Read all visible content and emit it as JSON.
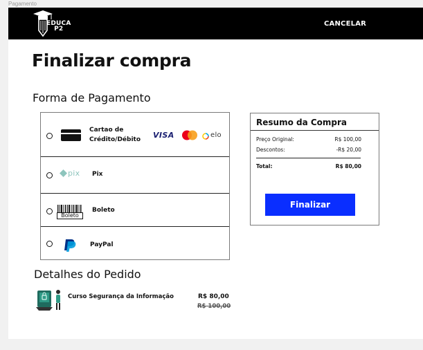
{
  "frame": {
    "label": "Pagamento"
  },
  "header": {
    "logo_line1": "EDUCA",
    "logo_line2": "P2",
    "cancel_label": "CANCELAR"
  },
  "page": {
    "title": "Finalizar compra"
  },
  "payment": {
    "section_title": "Forma de Pagamento",
    "methods": [
      {
        "label_line1": "Cartao de",
        "label_line2": "Crédito/Débito",
        "icon": "credit-card-icon",
        "brands": [
          "VISA",
          "mastercard",
          "elo"
        ]
      },
      {
        "label": "Pix",
        "icon": "pix-icon",
        "icon_text": "pix"
      },
      {
        "label": "Boleto",
        "icon": "barcode-icon",
        "icon_text": "Boleto"
      },
      {
        "label": "PayPal",
        "icon": "paypal-icon"
      }
    ]
  },
  "summary": {
    "title": "Resumo da Compra",
    "original_label": "Preço Original:",
    "original_value": "R$ 100,00",
    "discount_label": "Descontos:",
    "discount_value": "-R$  20,00",
    "total_label": "Total:",
    "total_value": "R$ 80,00",
    "button_label": "Finalizar"
  },
  "details": {
    "section_title": "Detalhes do Pedido",
    "item_name": "Curso Segurança da Informação",
    "price": "R$  80,00",
    "old_price": "R$ 100,00"
  },
  "colors": {
    "header_bg": "#000000",
    "accent_button": "#0a2eff",
    "visa": "#1a1f71",
    "mastercard_red": "#eb001b",
    "mastercard_yellow": "#f79e1b",
    "pix": "#32bcad",
    "paypal_dark": "#003087",
    "paypal_light": "#009cde"
  }
}
